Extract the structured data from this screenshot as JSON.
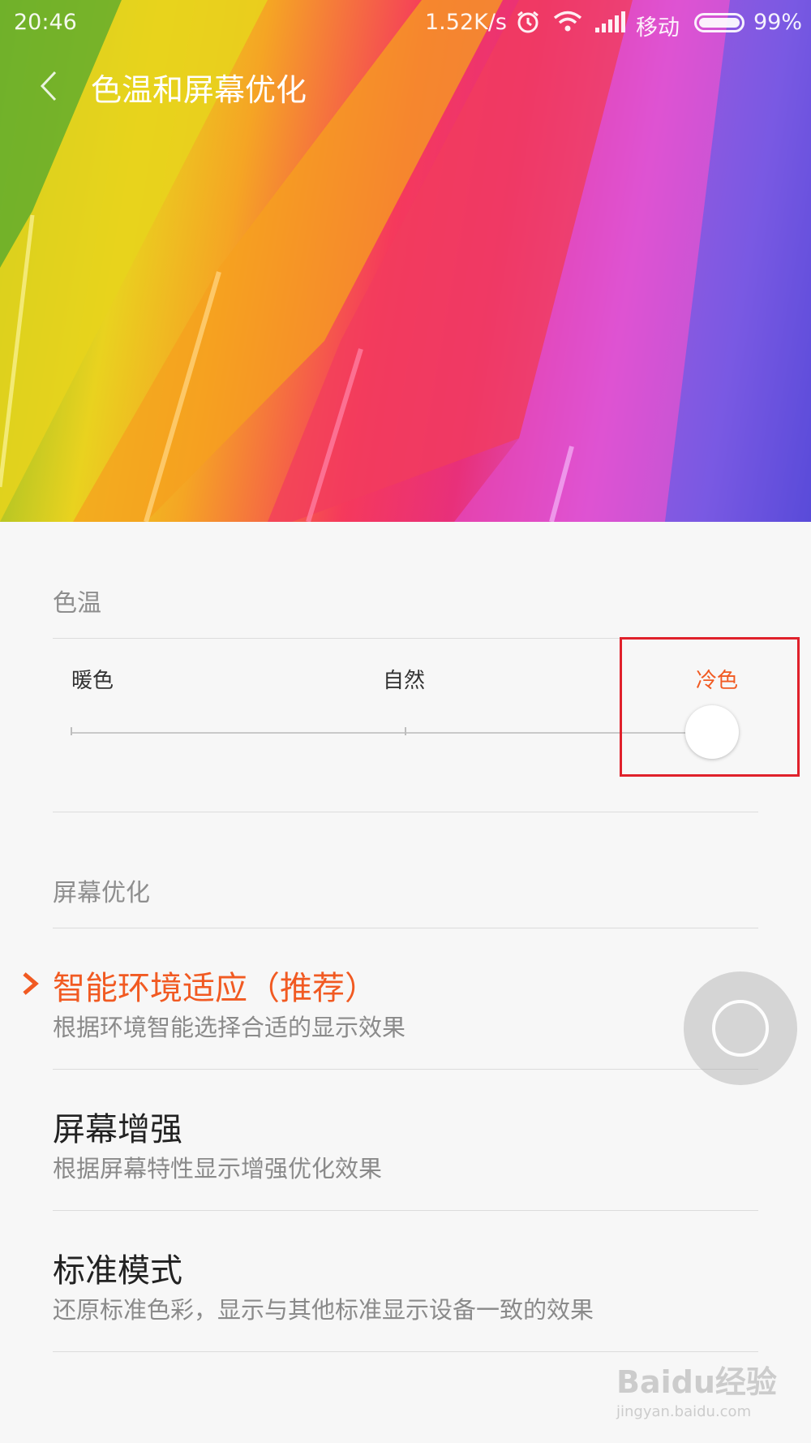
{
  "status_bar": {
    "time": "20:46",
    "net_speed": "1.52K/s",
    "carrier": "移动",
    "battery": "99%",
    "icons": [
      "alarm-icon",
      "wifi-icon",
      "signal-icon",
      "battery-icon"
    ]
  },
  "header": {
    "title": "色温和屏幕优化",
    "back_icon": "chevron-left-icon"
  },
  "color_temperature": {
    "section_title": "色温",
    "labels": [
      "暖色",
      "自然",
      "冷色"
    ],
    "selected_label": "冷色",
    "selected_color": "#f15a22",
    "slider_value": 1.0
  },
  "screen_optimization": {
    "section_title": "屏幕优化",
    "options": [
      {
        "title": "智能环境适应（推荐）",
        "description": "根据环境智能选择合适的显示效果",
        "selected": true
      },
      {
        "title": "屏幕增强",
        "description": "根据屏幕特性显示增强优化效果",
        "selected": false
      },
      {
        "title": "标准模式",
        "description": "还原标准色彩，显示与其他标准显示设备一致的效果",
        "selected": false
      }
    ]
  },
  "overlay": {
    "assistive_icon": "floating-ball-icon",
    "highlight_color": "#e0212b"
  },
  "watermark": {
    "logo": "Baidu经验",
    "url": "jingyan.baidu.com"
  }
}
